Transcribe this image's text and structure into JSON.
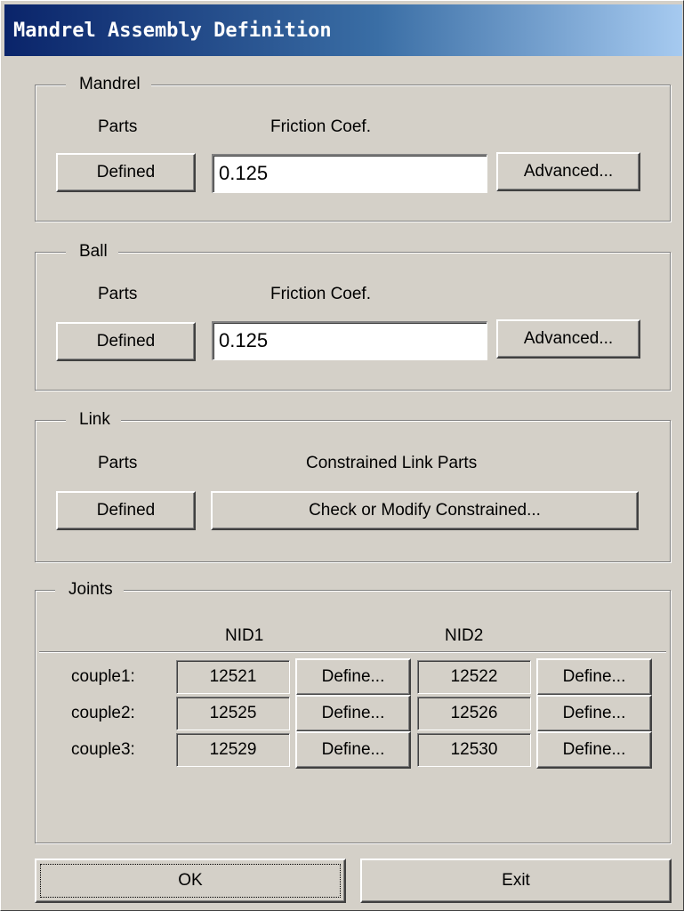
{
  "window": {
    "title": "Mandrel Assembly Definition"
  },
  "mandrel": {
    "legend": "Mandrel",
    "parts_label": "Parts",
    "friction_label": "Friction Coef.",
    "parts_button": "Defined",
    "friction_value": "0.125",
    "advanced_button": "Advanced..."
  },
  "ball": {
    "legend": "Ball",
    "parts_label": "Parts",
    "friction_label": "Friction Coef.",
    "parts_button": "Defined",
    "friction_value": "0.125",
    "advanced_button": "Advanced..."
  },
  "link": {
    "legend": "Link",
    "parts_label": "Parts",
    "constrained_label": "Constrained Link Parts",
    "parts_button": "Defined",
    "constrained_button": "Check or Modify Constrained..."
  },
  "joints": {
    "legend": "Joints",
    "nid1_header": "NID1",
    "nid2_header": "NID2",
    "rows": [
      {
        "label": "couple1:",
        "nid1": "12521",
        "define1": "Define...",
        "nid2": "12522",
        "define2": "Define..."
      },
      {
        "label": "couple2:",
        "nid1": "12525",
        "define1": "Define...",
        "nid2": "12526",
        "define2": "Define..."
      },
      {
        "label": "couple3:",
        "nid1": "12529",
        "define1": "Define...",
        "nid2": "12530",
        "define2": "Define..."
      }
    ]
  },
  "footer": {
    "ok_label": "OK",
    "exit_label": "Exit"
  }
}
